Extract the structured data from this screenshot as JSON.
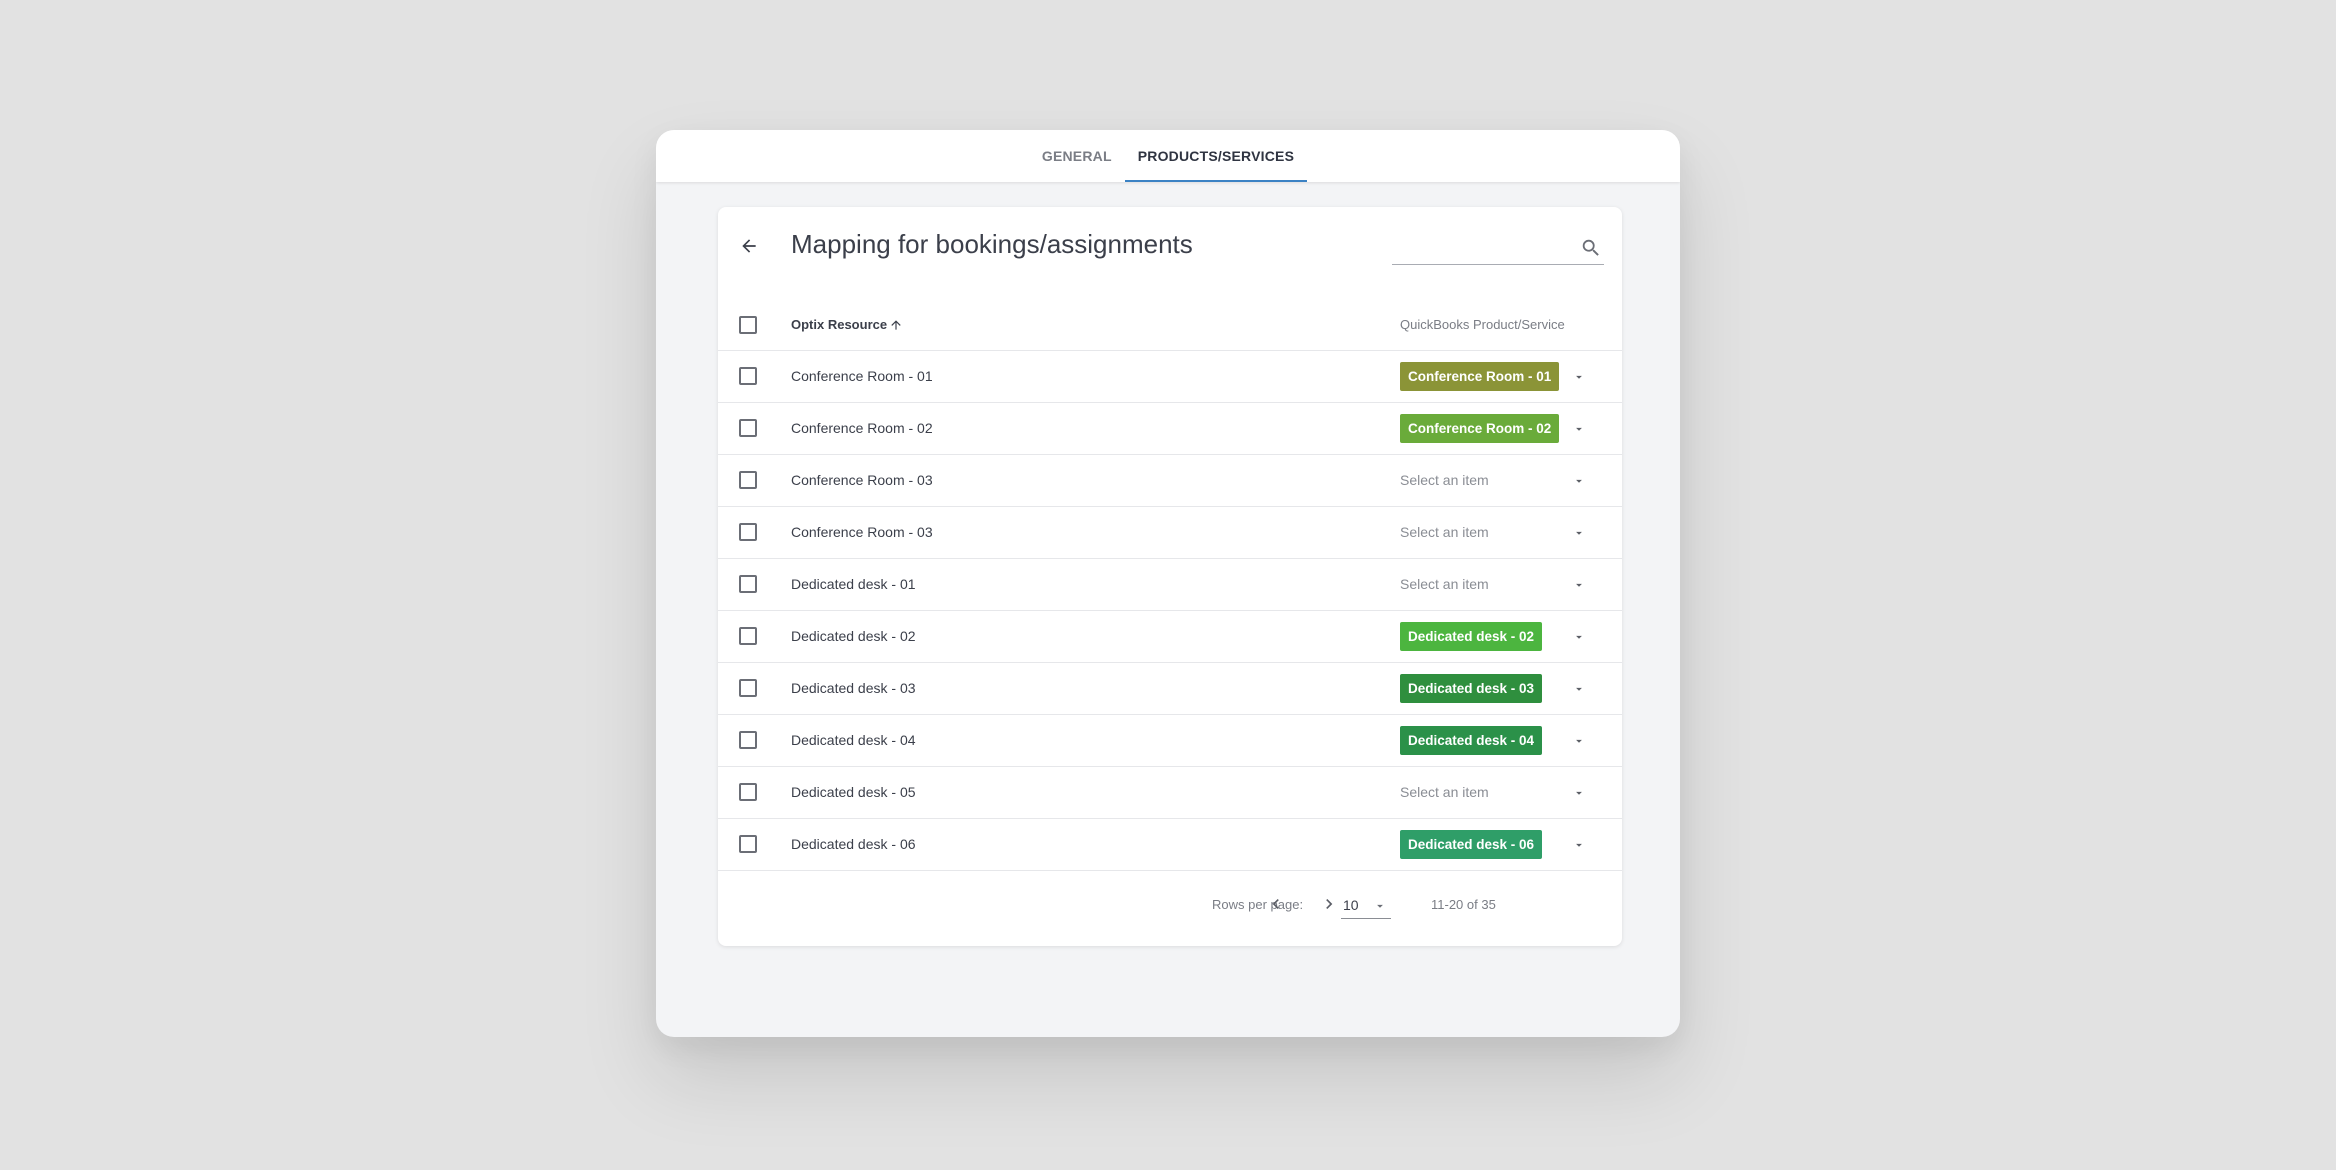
{
  "tabs": [
    {
      "label": "GENERAL",
      "active": false
    },
    {
      "label": "PRODUCTS/SERVICES",
      "active": true
    }
  ],
  "page_title": "Mapping for bookings/assignments",
  "search": {
    "value": "",
    "placeholder": ""
  },
  "table": {
    "columns": {
      "resource": "Optix Resource",
      "product": "QuickBooks Product/Service"
    },
    "sort": "ascending",
    "rows": [
      {
        "resource": "Conference Room - 01",
        "mapped": "Conference Room - 01",
        "chip_color": "#8b9437"
      },
      {
        "resource": "Conference Room - 02",
        "mapped": "Conference Room - 02",
        "chip_color": "#6aab3a"
      },
      {
        "resource": "Conference Room - 03",
        "mapped": "",
        "placeholder": "Select an item"
      },
      {
        "resource": "Conference Room - 03",
        "mapped": "",
        "placeholder": "Select an item"
      },
      {
        "resource": "Dedicated desk - 01",
        "mapped": "",
        "placeholder": "Select an item"
      },
      {
        "resource": "Dedicated desk - 02",
        "mapped": "Dedicated desk - 02",
        "chip_color": "#4cb53f"
      },
      {
        "resource": "Dedicated desk - 03",
        "mapped": "Dedicated desk - 03",
        "chip_color": "#2f8f3e"
      },
      {
        "resource": "Dedicated desk - 04",
        "mapped": "Dedicated desk - 04",
        "chip_color": "#2b9149"
      },
      {
        "resource": "Dedicated desk - 05",
        "mapped": "",
        "placeholder": "Select an item"
      },
      {
        "resource": "Dedicated desk - 06",
        "mapped": "Dedicated desk - 06",
        "chip_color": "#2f9e68"
      }
    ]
  },
  "pagination": {
    "rows_per_page_label": "Rows per page:",
    "rows_per_page": "10",
    "range": "11-20 of 35"
  },
  "colors": {
    "accent": "#3b82c4",
    "background": "#e2e2e2",
    "panel": "#f3f4f6"
  },
  "icons": {
    "back": "arrow-left-icon",
    "search": "search-icon",
    "sort": "arrow-up-icon",
    "dropdown": "caret-down-icon",
    "prev": "chevron-left-icon",
    "next": "chevron-right-icon"
  }
}
